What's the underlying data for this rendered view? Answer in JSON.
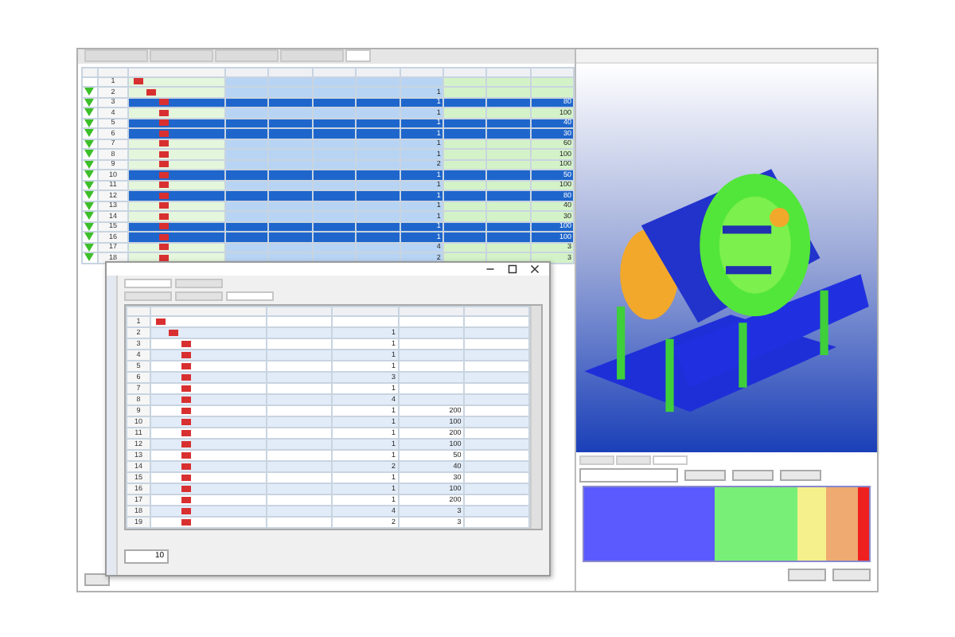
{
  "main_tabs": [
    {
      "selected": false
    },
    {
      "selected": false
    },
    {
      "selected": false
    },
    {
      "selected": false
    },
    {
      "selected": true
    }
  ],
  "main_grid": {
    "rows": [
      {
        "no": "1",
        "selected": false,
        "children": [
          {
            "no": "2",
            "qty": "1",
            "selected": false,
            "children": [
              {
                "no": "3",
                "qty": "1",
                "value": "80",
                "selected": true
              },
              {
                "no": "4",
                "qty": "1",
                "value": "100",
                "selected": false
              },
              {
                "no": "5",
                "qty": "1",
                "value": "40",
                "selected": true
              },
              {
                "no": "6",
                "qty": "1",
                "value": "30",
                "selected": true
              },
              {
                "no": "7",
                "qty": "1",
                "value": "60",
                "selected": false
              },
              {
                "no": "8",
                "qty": "1",
                "value": "100",
                "selected": false
              },
              {
                "no": "9",
                "qty": "2",
                "value": "100",
                "selected": false
              },
              {
                "no": "10",
                "qty": "1",
                "value": "50",
                "selected": true
              },
              {
                "no": "11",
                "qty": "1",
                "value": "100",
                "selected": false
              },
              {
                "no": "12",
                "qty": "1",
                "value": "80",
                "selected": true
              },
              {
                "no": "13",
                "qty": "1",
                "value": "40",
                "selected": false
              },
              {
                "no": "14",
                "qty": "1",
                "value": "30",
                "selected": false
              },
              {
                "no": "15",
                "qty": "1",
                "value": "100",
                "selected": true
              },
              {
                "no": "16",
                "qty": "1",
                "value": "100",
                "selected": true
              },
              {
                "no": "17",
                "qty": "4",
                "value": "3",
                "selected": false
              },
              {
                "no": "18",
                "qty": "2",
                "value": "3",
                "selected": false
              }
            ]
          }
        ]
      }
    ]
  },
  "dialog": {
    "tabs": [
      {
        "selected": true
      },
      {
        "selected": false
      }
    ],
    "subtabs": [
      {
        "selected": false
      },
      {
        "selected": false
      },
      {
        "selected": true
      }
    ],
    "rows": [
      {
        "no": "1",
        "children": [
          {
            "no": "2",
            "qty": "1",
            "children": [
              {
                "no": "3",
                "qty": "1"
              },
              {
                "no": "4",
                "qty": "1"
              },
              {
                "no": "5",
                "qty": "1"
              },
              {
                "no": "6",
                "qty": "3"
              },
              {
                "no": "7",
                "qty": "1"
              },
              {
                "no": "8",
                "qty": "4"
              },
              {
                "no": "9",
                "qty": "1",
                "value": "200"
              },
              {
                "no": "10",
                "qty": "1",
                "value": "100"
              },
              {
                "no": "11",
                "qty": "1",
                "value": "200"
              },
              {
                "no": "12",
                "qty": "1",
                "value": "100"
              },
              {
                "no": "13",
                "qty": "1",
                "value": "50"
              },
              {
                "no": "14",
                "qty": "2",
                "value": "40"
              },
              {
                "no": "15",
                "qty": "1",
                "value": "30"
              },
              {
                "no": "16",
                "qty": "1",
                "value": "100"
              },
              {
                "no": "17",
                "qty": "1",
                "value": "200"
              },
              {
                "no": "18",
                "qty": "4",
                "value": "3"
              },
              {
                "no": "19",
                "qty": "2",
                "value": "3"
              }
            ]
          }
        ]
      }
    ],
    "depth_value": "10"
  },
  "lower_tabs": [
    {
      "selected": false
    },
    {
      "selected": false
    },
    {
      "selected": true
    }
  ],
  "color_bar": [
    {
      "color": "#5a5aff"
    },
    {
      "color": "#78f078"
    },
    {
      "color": "#f5f08c"
    },
    {
      "color": "#eeaa70"
    },
    {
      "color": "#ee2020"
    }
  ]
}
